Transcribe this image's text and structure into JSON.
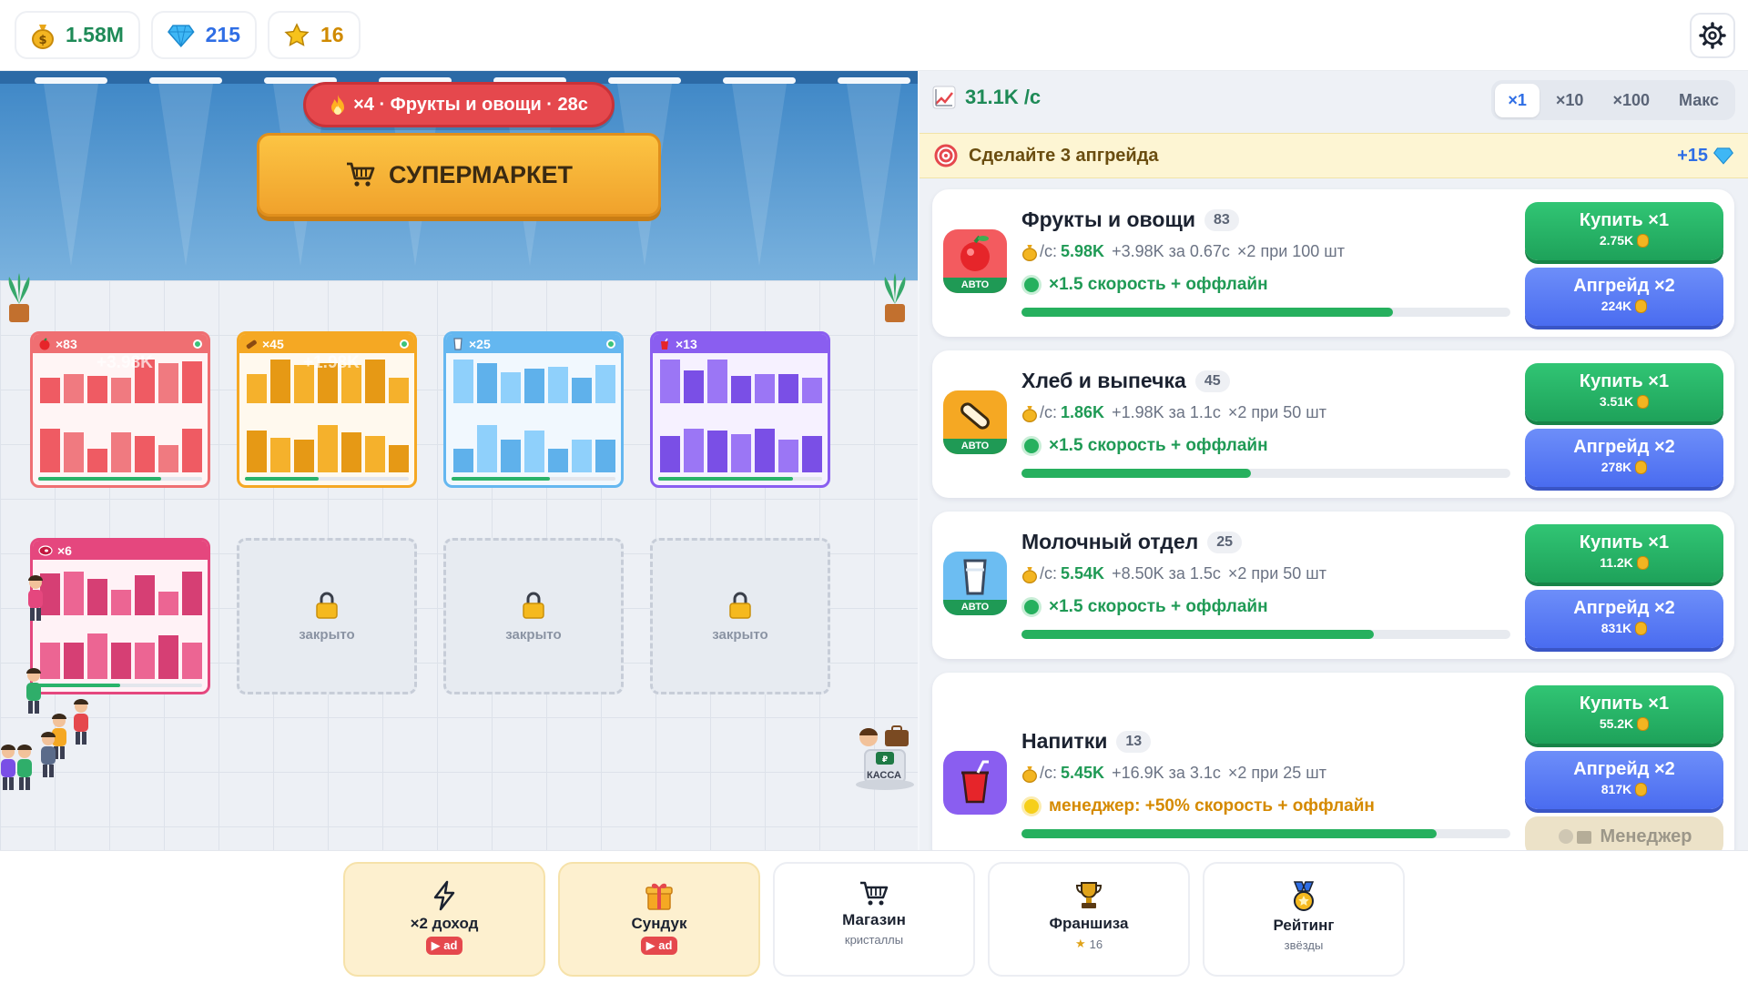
{
  "resources": {
    "coins": "1.58M",
    "gems": "215",
    "stars": "16"
  },
  "scene": {
    "boost_text": "×4 · Фрукты и овощи · 28с",
    "store_title": "СУПЕРМАРКЕТ",
    "shelves": [
      {
        "count": "×83",
        "earn": "+3.98K",
        "color": "#ef6f72"
      },
      {
        "count": "×45",
        "earn": "+1.98K",
        "color": "#f5a823"
      },
      {
        "count": "×25",
        "earn": "",
        "color": "#64b7f0"
      },
      {
        "count": "×13",
        "earn": "",
        "color": "#8a5ef0"
      },
      {
        "count": "×6",
        "earn": "",
        "color": "#e5477e"
      }
    ],
    "locked_label": "закрыто",
    "register_label": "КАССА"
  },
  "panel": {
    "rate": "31.1K /с",
    "multipliers": [
      "×1",
      "×10",
      "×100",
      "Макс"
    ],
    "active_multiplier": "×1",
    "quest": {
      "text": "Сделайте 3 апгрейда",
      "reward": "+15"
    },
    "per_sec_label": "/с:",
    "departments": [
      {
        "name": "Фрукты и овощи",
        "level": "83",
        "per_sec": "5.98K",
        "per_cycle": "+3.98K за 0.67с",
        "milestone": "×2 при 100 шт",
        "bonus": "×1.5 скорость + оффлайн",
        "auto": "АВТО",
        "progress": 0.76,
        "buy_label": "Купить ×1",
        "buy_cost": "2.75K",
        "upgrade_label": "Апгрейд ×2",
        "upgrade_cost": "224K"
      },
      {
        "name": "Хлеб и выпечка",
        "level": "45",
        "per_sec": "1.86K",
        "per_cycle": "+1.98K за 1.1с",
        "milestone": "×2 при 50 шт",
        "bonus": "×1.5 скорость + оффлайн",
        "auto": "АВТО",
        "progress": 0.47,
        "buy_label": "Купить ×1",
        "buy_cost": "3.51K",
        "upgrade_label": "Апгрейд ×2",
        "upgrade_cost": "278K"
      },
      {
        "name": "Молочный отдел",
        "level": "25",
        "per_sec": "5.54K",
        "per_cycle": "+8.50K за 1.5с",
        "milestone": "×2 при 50 шт",
        "bonus": "×1.5 скорость + оффлайн",
        "auto": "АВТО",
        "progress": 0.72,
        "buy_label": "Купить ×1",
        "buy_cost": "11.2K",
        "upgrade_label": "Апгрейд ×2",
        "upgrade_cost": "831K"
      },
      {
        "name": "Напитки",
        "level": "13",
        "per_sec": "5.45K",
        "per_cycle": "+16.9K за 3.1с",
        "milestone": "×2 при 25 шт",
        "bonus": "менеджер: +50% скорость + оффлайн",
        "progress": 0.85,
        "buy_label": "Купить ×1",
        "buy_cost": "55.2K",
        "upgrade_label": "Апгрейд ×2",
        "upgrade_cost": "817K",
        "manager_label": "Менеджер"
      }
    ]
  },
  "bottom_tabs": [
    {
      "label": "×2 доход",
      "sub": "ad",
      "icon": "lightning-icon"
    },
    {
      "label": "Сундук",
      "sub": "ad",
      "icon": "gift-icon"
    },
    {
      "label": "Магазин",
      "sub": "кристаллы",
      "icon": "cart-icon"
    },
    {
      "label": "Франшиза",
      "sub": "16",
      "icon": "trophy-icon"
    },
    {
      "label": "Рейтинг",
      "sub": "звёзды",
      "icon": "medal-icon"
    }
  ],
  "colors": {
    "accent_green": "#1f9a55",
    "accent_blue": "#2f6ee5",
    "boost_red": "#e5484d",
    "title_gold": "#f5b233"
  }
}
